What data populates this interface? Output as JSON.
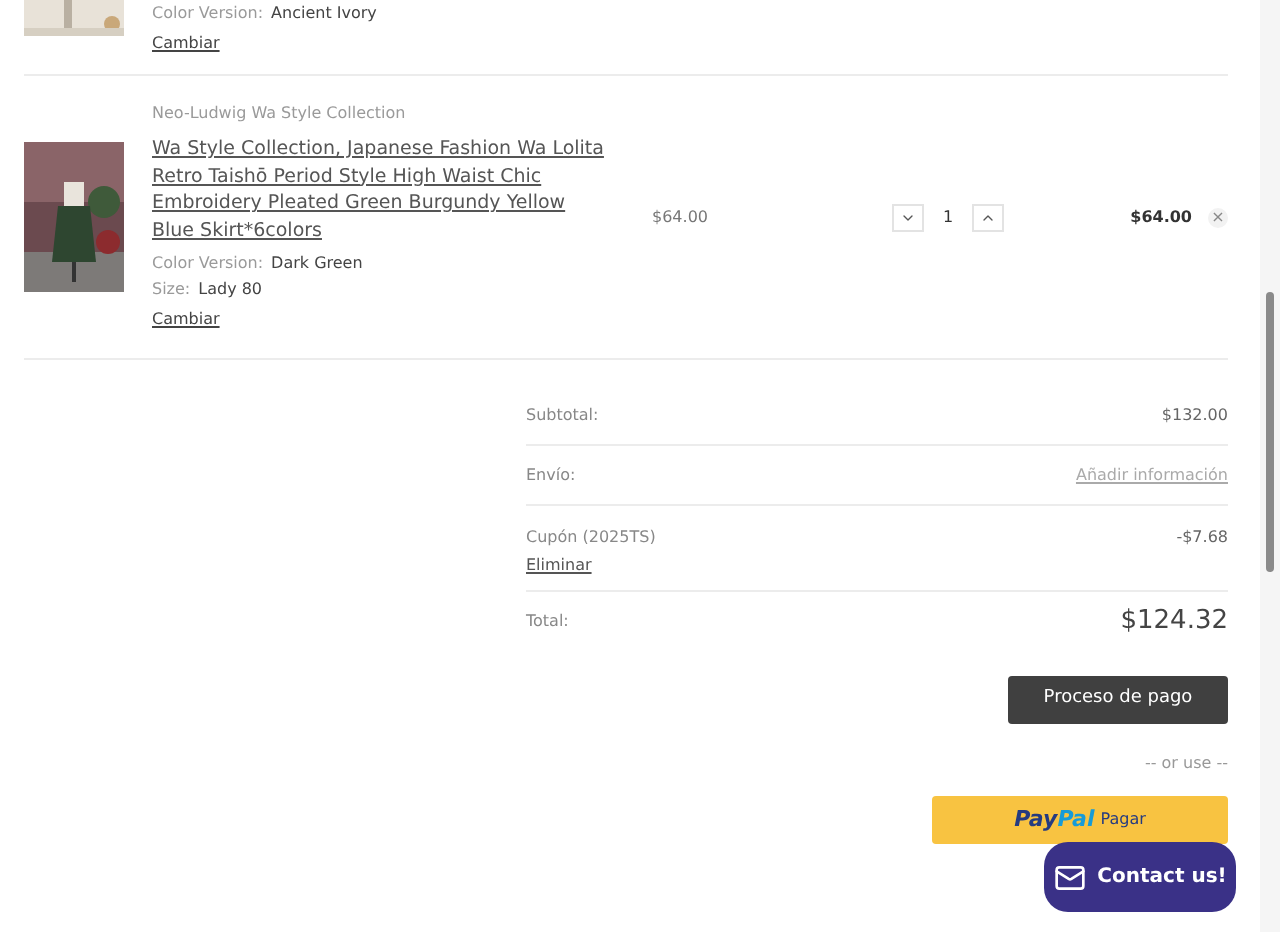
{
  "items": [
    {
      "kind": "partial",
      "options": [
        {
          "label": "Color Version:",
          "value": "Ancient Ivory"
        }
      ],
      "change": "Cambiar"
    },
    {
      "kind": "full",
      "brand": "Neo-Ludwig Wa Style Collection",
      "title": "Wa Style Collection, Japanese Fashion Wa Lolita Retro Taishō Period Style High Waist Chic Embroidery Pleated Green Burgundy Yellow Blue Skirt*6colors",
      "options": [
        {
          "label": "Color Version:",
          "value": "Dark Green"
        },
        {
          "label": "Size:",
          "value": "Lady 80"
        }
      ],
      "change": "Cambiar",
      "price": "$64.00",
      "quantity": "1",
      "total": "$64.00",
      "remove": "×"
    }
  ],
  "summary": {
    "subtotal": {
      "label": "Subtotal:",
      "value": "$132.00"
    },
    "shipping": {
      "label": "Envío:",
      "link": "Añadir información"
    },
    "coupon": {
      "label": "Cupón (2025TS)",
      "remove": "Eliminar",
      "value": "-$7.68"
    },
    "total": {
      "label": "Total:",
      "value": "$124.32"
    }
  },
  "checkout": "Proceso de pago",
  "or_use": "-- or use --",
  "paypal": {
    "logo_parts": [
      "Pay",
      "Pal"
    ],
    "label": "Pagar"
  },
  "contact": "Contact us!"
}
